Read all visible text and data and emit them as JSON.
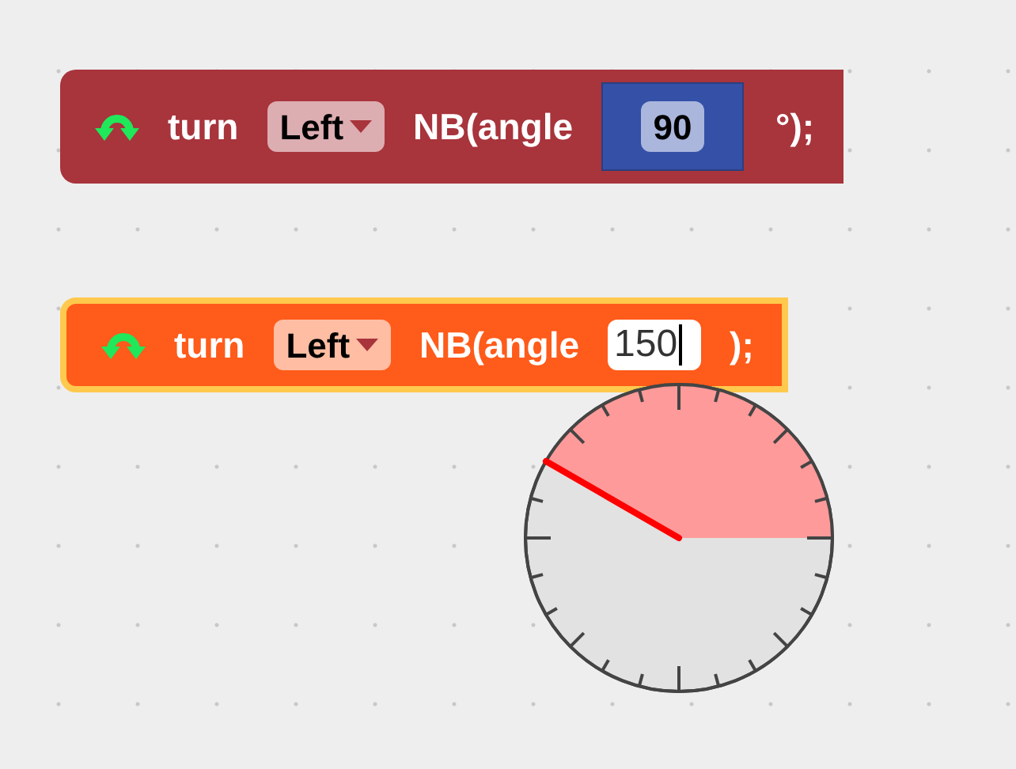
{
  "blocks": [
    {
      "color": "#a8343c",
      "selected": false,
      "parts": [
        {
          "kind": "label",
          "text": "turn"
        },
        {
          "kind": "dropdown",
          "text": "Left"
        },
        {
          "kind": "label",
          "text": "NB(angle"
        },
        {
          "kind": "number_block",
          "text": "90"
        },
        {
          "kind": "label",
          "text": "°);"
        }
      ]
    },
    {
      "color": "#ff5b1a",
      "selected": true,
      "parts": [
        {
          "kind": "label",
          "text": "turn"
        },
        {
          "kind": "dropdown",
          "text": "Left"
        },
        {
          "kind": "label",
          "text": "NB(angle"
        },
        {
          "kind": "text_input",
          "text": "150"
        },
        {
          "kind": "label",
          "text": ");"
        }
      ]
    }
  ]
}
